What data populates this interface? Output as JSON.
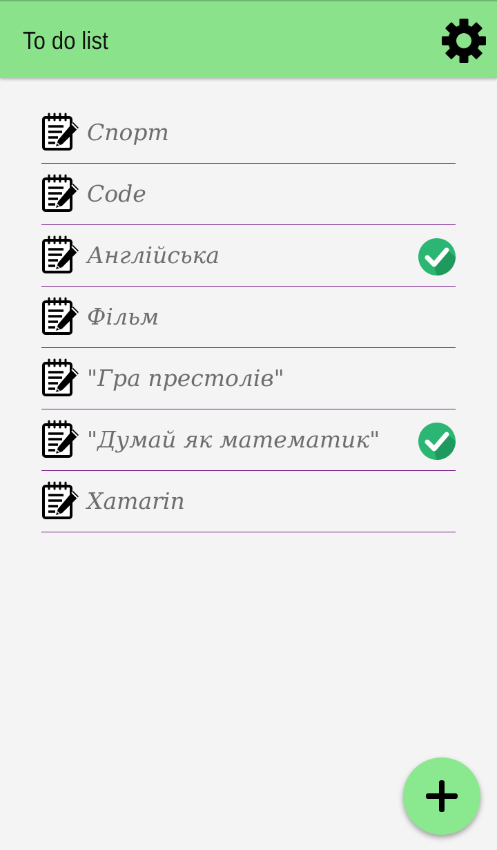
{
  "app_bar": {
    "title": "To do list",
    "background_color": "#8ae38a",
    "settings_icon": "gear-icon"
  },
  "tasks": [
    {
      "label": "Спорт",
      "icon": "notepad-pencil-icon",
      "done": false
    },
    {
      "label": "Code",
      "icon": "notepad-pencil-icon",
      "done": false
    },
    {
      "label": "Англійська",
      "icon": "notepad-pencil-icon",
      "done": true
    },
    {
      "label": "Фільм",
      "icon": "notepad-pencil-icon",
      "done": false
    },
    {
      "label": "\"Гра престолів\"",
      "icon": "notepad-pencil-icon",
      "done": false
    },
    {
      "label": "\"Думай як математик\"",
      "icon": "notepad-pencil-icon",
      "done": true
    },
    {
      "label": "Xamarin",
      "icon": "notepad-pencil-icon",
      "done": false
    }
  ],
  "colors": {
    "divider": "#7b1a8c",
    "done_check": "#2bb673",
    "task_text": "#6d6d6d",
    "page_background": "#f4f4f4"
  },
  "fab": {
    "icon": "plus-icon",
    "background_color": "#8ae88f"
  }
}
